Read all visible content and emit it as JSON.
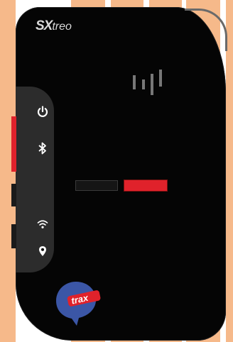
{
  "brand": {
    "logo_prefix": "SX",
    "logo_suffix": "treo"
  },
  "logos": {
    "trax": "trax"
  },
  "icons": [
    "power-icon",
    "bluetooth-icon",
    "wifi-icon",
    "location-icon"
  ],
  "colors": {
    "device": "#050505",
    "side_panel": "#2c2c2c",
    "accent_red": "#e0222b",
    "stripe_orange": "#f6b98a",
    "logo_blue": "#3b56a6"
  }
}
